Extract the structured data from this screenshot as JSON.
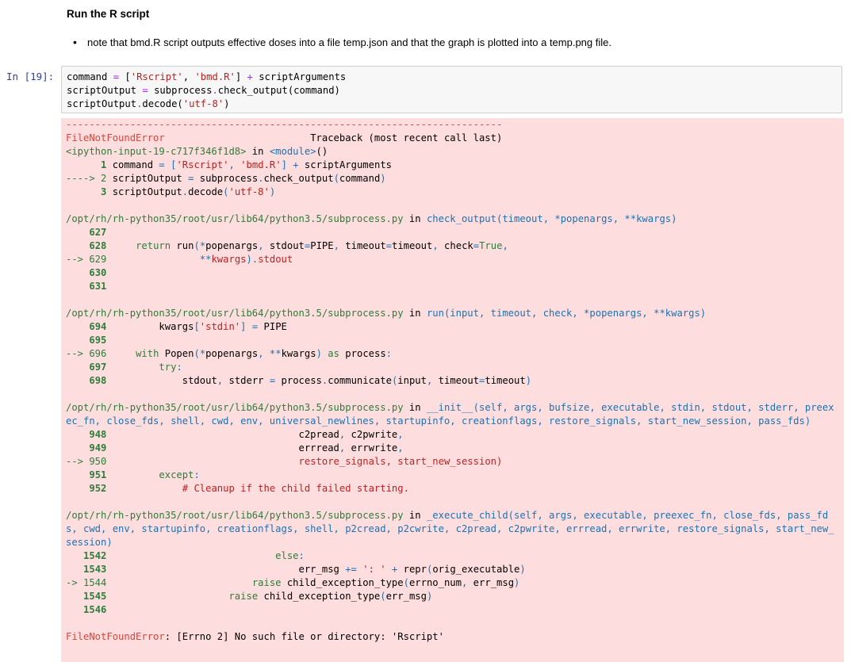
{
  "markdown": {
    "heading": "Run the R script",
    "bullet": "note that bmd.R script outputs effective doses into a file temp.json and that the graph is plotted into a temp.png file."
  },
  "input_cell": {
    "prompt": "In [19]:",
    "lines": [
      "command = ['Rscript', 'bmd.R'] + scriptArguments",
      "scriptOutput = subprocess.check_output(command)",
      "scriptOutput.decode('utf-8')"
    ]
  },
  "traceback": {
    "separator": "---------------------------------------------------------------------------",
    "error_name": "FileNotFoundError",
    "header_right": "Traceback (most recent call last)",
    "input_ref": "<ipython-input-19-c717f346f1d8>",
    "input_ref_in": " in ",
    "input_ref_module": "<module>",
    "input_ref_parens": "()",
    "final_error_name": "FileNotFoundError",
    "final_error_msg": ": [Errno 2] No such file or directory: 'Rscript'"
  },
  "colors": {
    "error_bg": "#fddddd",
    "input_bg": "#f7f7f7",
    "prompt": "#303f9f"
  }
}
